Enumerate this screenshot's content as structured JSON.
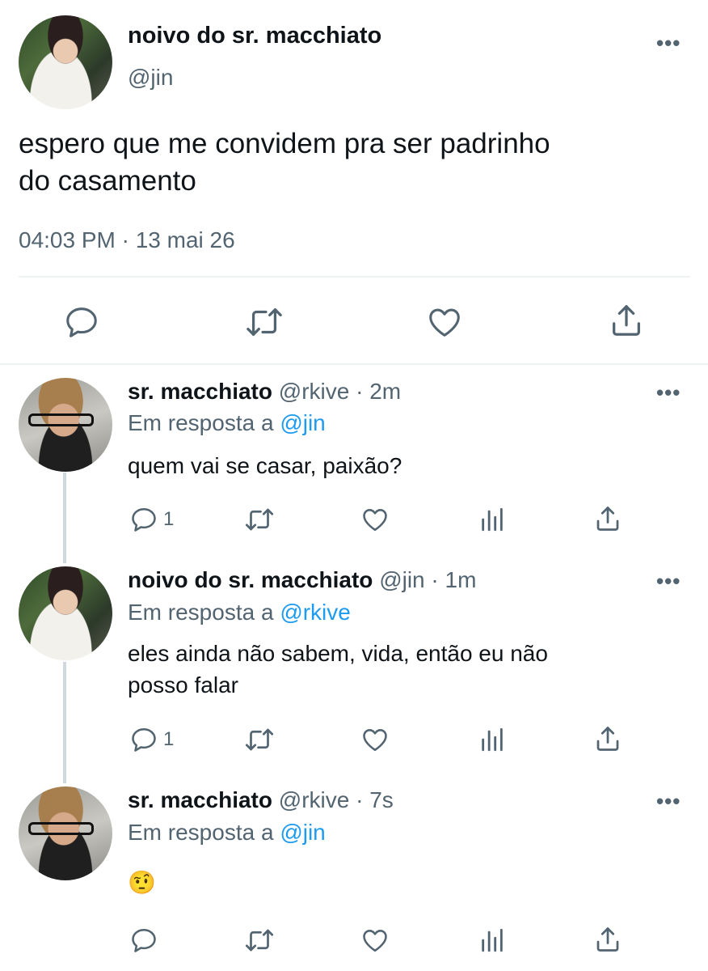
{
  "main_tweet": {
    "display_name": "noivo do sr. macchiato",
    "handle": "@jin",
    "text_line1": "espero que me convidem pra ser padrinho",
    "text_line2": "do casamento",
    "timestamp": "04:03 PM · 13 mai 26",
    "more": "•••"
  },
  "replies": [
    {
      "display_name": "sr. macchiato",
      "meta": "@rkive · 2m",
      "reply_prefix": "Em resposta a ",
      "reply_to": "@jin",
      "text_line1": "quem vai se casar, paixão?",
      "text_line2": "",
      "reply_count": "1",
      "more": "•••"
    },
    {
      "display_name": "noivo do sr. macchiato",
      "meta": "@jin · 1m",
      "reply_prefix": "Em resposta a ",
      "reply_to": "@rkive",
      "text_line1": "eles ainda não sabem, vida, então eu não",
      "text_line2": "posso falar",
      "reply_count": "1",
      "more": "•••"
    },
    {
      "display_name": "sr. macchiato",
      "meta": "@rkive · 7s",
      "reply_prefix": "Em resposta a ",
      "reply_to": "@jin",
      "text_line1": "🤨",
      "text_line2": "",
      "reply_count": "",
      "more": "•••"
    }
  ],
  "colors": {
    "accent": "#1d9bf0",
    "muted": "#536471",
    "divider": "#eff3f4",
    "thread": "#cfd9de"
  },
  "icons": [
    "reply-icon",
    "retweet-icon",
    "like-icon",
    "views-icon",
    "share-icon",
    "more-icon"
  ]
}
